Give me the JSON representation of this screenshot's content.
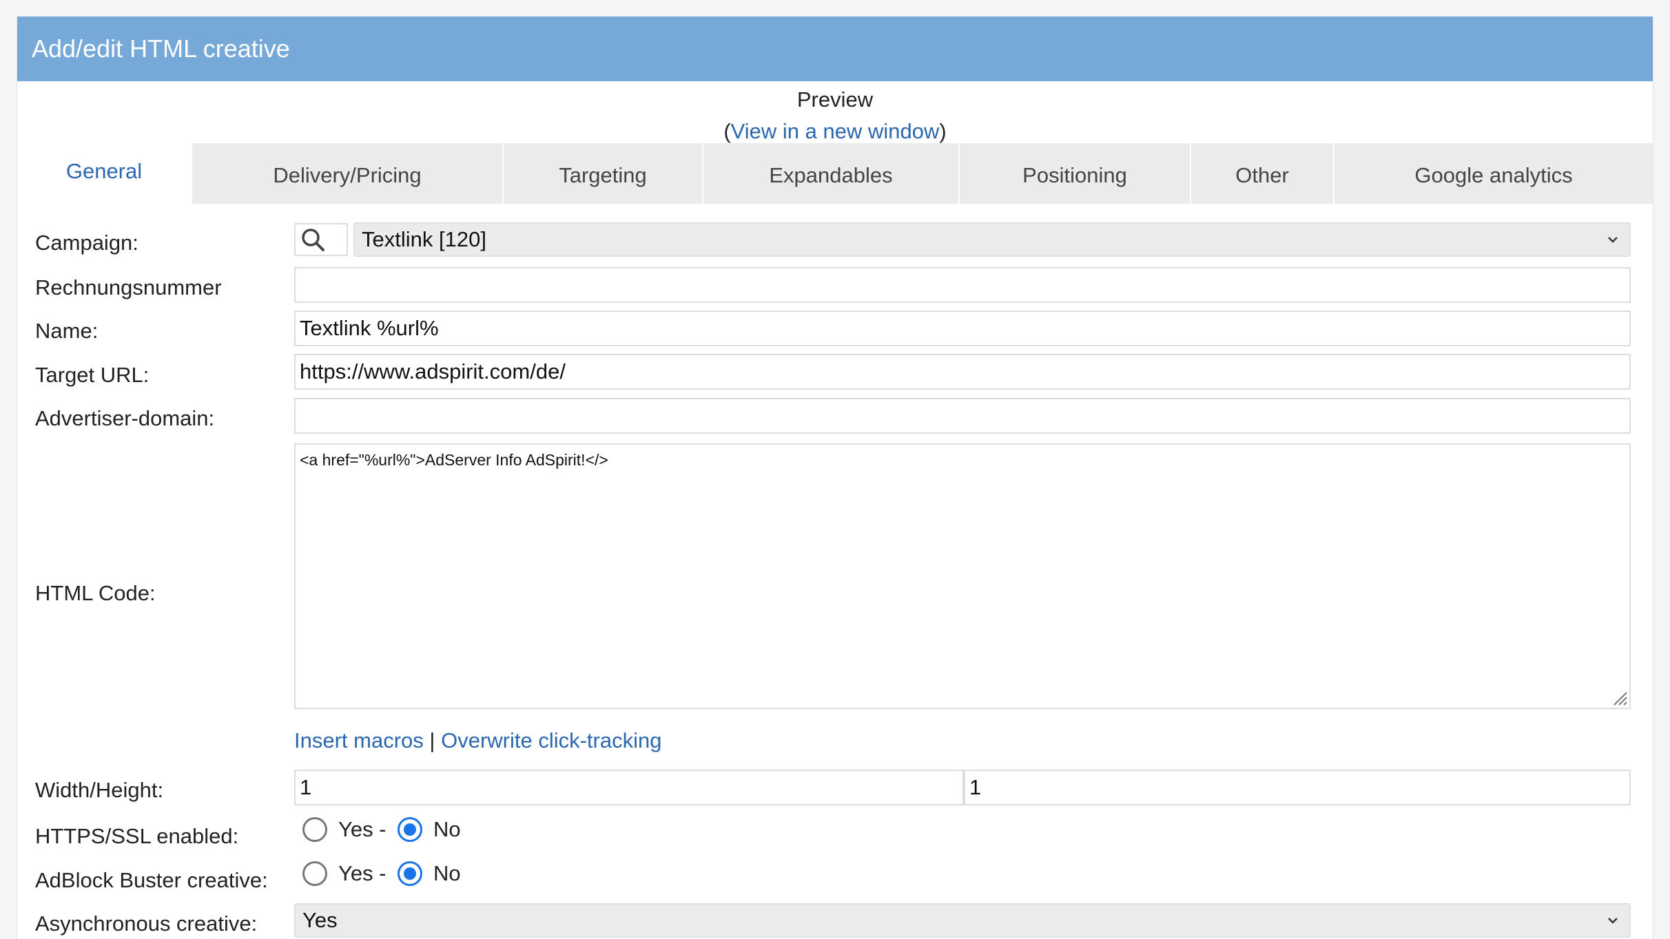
{
  "header": {
    "title": "Add/edit HTML creative"
  },
  "preview": {
    "title": "Preview",
    "open_paren": "(",
    "link_label": "View in a new window",
    "close_paren": ")"
  },
  "tabs": [
    {
      "label": "General",
      "active": true
    },
    {
      "label": "Delivery/Pricing"
    },
    {
      "label": "Targeting"
    },
    {
      "label": "Expandables"
    },
    {
      "label": "Positioning"
    },
    {
      "label": "Other"
    },
    {
      "label": "Google analytics"
    }
  ],
  "form": {
    "campaign": {
      "label": "Campaign:",
      "value": "Textlink [120]"
    },
    "invoice_number": {
      "label": "Rechnungsnummer",
      "value": ""
    },
    "name": {
      "label": "Name:",
      "value": "Textlink %url%"
    },
    "target_url": {
      "label": "Target URL:",
      "value": "https://www.adspirit.com/de/"
    },
    "advertiser_domain": {
      "label": "Advertiser-domain:",
      "value": ""
    },
    "html_code": {
      "label": "HTML Code:",
      "value": "<a href=\"%url%\">AdServer Info AdSpirit!</>"
    },
    "links": {
      "insert_macros": "Insert macros",
      "separator": "|",
      "overwrite_click_tracking": "Overwrite click-tracking"
    },
    "width_height": {
      "label": "Width/Height:",
      "width": "1",
      "height": "1"
    },
    "https_ssl": {
      "label": "HTTPS/SSL enabled:",
      "yes_label": "Yes -",
      "no_label": "No",
      "selected": "No"
    },
    "adblock_buster": {
      "label": "AdBlock Buster creative:",
      "yes_label": "Yes -",
      "no_label": "No",
      "selected": "No"
    },
    "asynchronous": {
      "label": "Asynchronous creative:",
      "value": "Yes"
    }
  },
  "colors": {
    "header_bg": "#76a9d8",
    "link": "#2b67b1",
    "radio_checked": "#1a73e8",
    "tab_bg": "#ebebeb"
  },
  "icons": {
    "search": "search-icon",
    "dropdown": "chevron-down-icon",
    "resize": "resize-grip-icon"
  }
}
